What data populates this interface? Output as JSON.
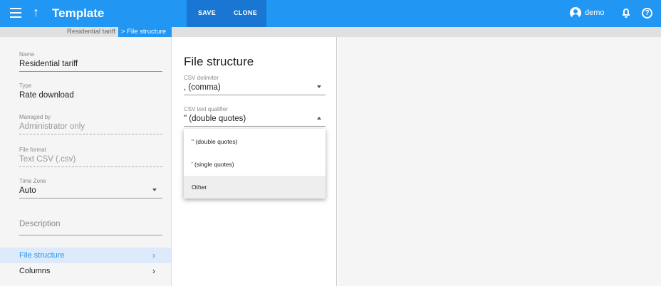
{
  "header": {
    "title": "Template",
    "save_label": "SAVE",
    "clone_label": "CLONE",
    "user_name": "demo"
  },
  "breadcrumb": {
    "previous": "Residential tariff",
    "current": "File structure"
  },
  "left_panel": {
    "fields": [
      {
        "label": "Name",
        "value": "Residential tariff"
      },
      {
        "label": "Type",
        "value": "Rate download"
      },
      {
        "label": "Managed by",
        "value": "Administrator only"
      },
      {
        "label": "File format",
        "value": "Text CSV (.csv)"
      },
      {
        "label": "Time Zone",
        "value": "Auto"
      }
    ],
    "description_placeholder": "Description",
    "nav": [
      {
        "label": "File structure",
        "active": true
      },
      {
        "label": "Columns",
        "active": false
      }
    ]
  },
  "middle_panel": {
    "section_title": "File structure",
    "csv_delimiter": {
      "label": "CSV delimiter",
      "value": ", (comma)"
    },
    "csv_text_qualifier": {
      "label": "CSV text qualifier",
      "value": "\" (double quotes)"
    },
    "dropdown_options": [
      "\" (double quotes)",
      "' (single quotes)",
      "Other"
    ]
  },
  "colors": {
    "primary": "#2196f3",
    "primary_dark": "#1976d2",
    "active_nav_bg": "#ddeafb"
  }
}
